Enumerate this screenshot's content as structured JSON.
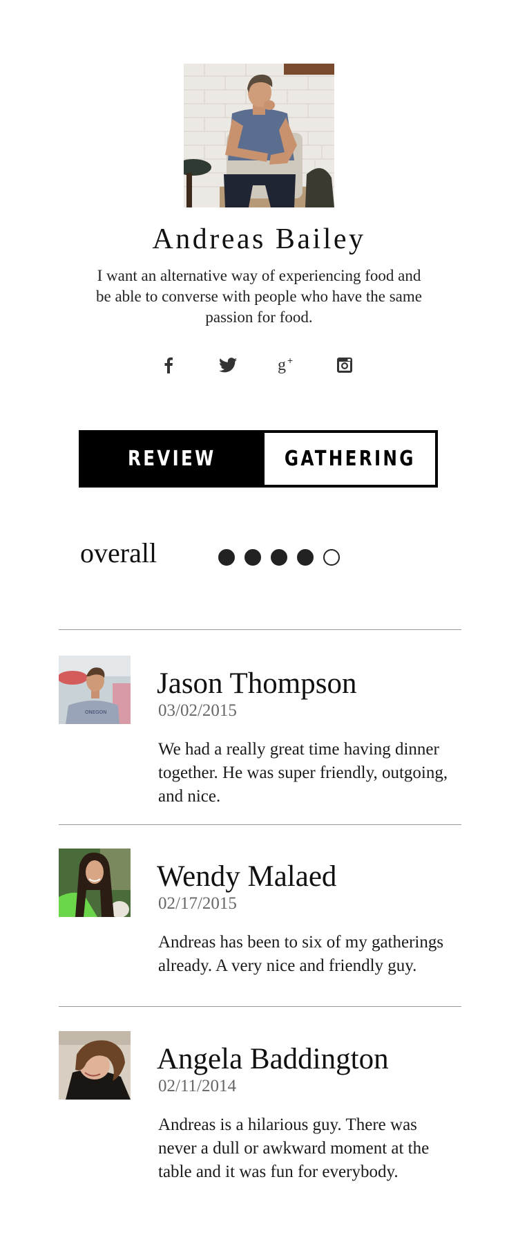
{
  "profile": {
    "name": "Andreas Bailey",
    "bio": "I want an alternative way of experiencing food and be able to converse with people who have the same passion for food.",
    "photo": "profile-photo"
  },
  "social": [
    {
      "name": "facebook",
      "icon": "facebook-icon",
      "glyph": "f"
    },
    {
      "name": "twitter",
      "icon": "twitter-icon"
    },
    {
      "name": "google-plus",
      "icon": "google-plus-icon",
      "glyph": "g+"
    },
    {
      "name": "instagram",
      "icon": "instagram-icon"
    }
  ],
  "tabs": [
    {
      "label": "REVIEW",
      "active": true
    },
    {
      "label": "GATHERING",
      "active": false
    }
  ],
  "overall": {
    "label": "overall",
    "rating": 4,
    "max": 5
  },
  "reviews": [
    {
      "name": "Jason Thompson",
      "date": "03/02/2015",
      "text": "We had a really great time having dinner together. He was super friendly, outgoing, and nice.",
      "avatar": "reviewer-photo"
    },
    {
      "name": "Wendy Malaed",
      "date": "02/17/2015",
      "text": "Andreas has been to six of my gatherings already. A very nice and friendly guy.",
      "avatar": "reviewer-photo"
    },
    {
      "name": "Angela Baddington",
      "date": "02/11/2014",
      "text": "Andreas is a hilarious guy. There was never a dull or awkward moment at the table and it was fun for everybody.",
      "avatar": "reviewer-photo"
    }
  ],
  "colors": {
    "text": "#1c1c1c",
    "date": "#666666",
    "divider": "#999999",
    "tab_active_bg": "#000000",
    "tab_active_text": "#ffffff"
  }
}
